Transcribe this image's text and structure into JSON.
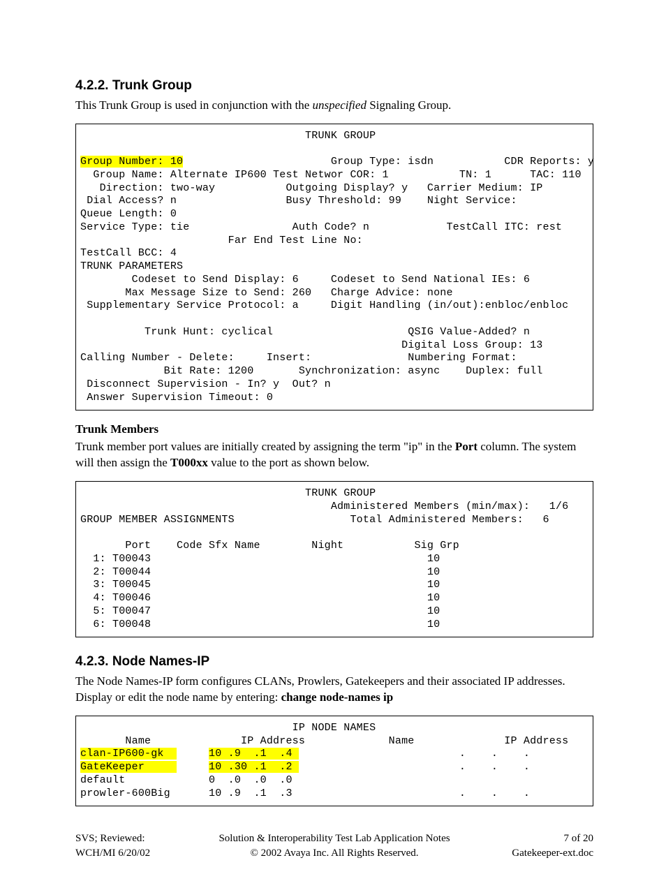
{
  "sections": {
    "trunk_group": {
      "number": "4.2.2.",
      "title": "Trunk Group",
      "intro_a": "This Trunk Group is used in conjunction with the ",
      "intro_b": "unspecified",
      "intro_c": " Signaling Group."
    },
    "trunk_members": {
      "heading": "Trunk Members",
      "p_a": "Trunk member port values are initially created by assigning the term \"ip\" in the ",
      "p_b": "Port",
      "p_c": " column. The system will then assign the ",
      "p_d": "T000xx",
      "p_e": " value to the port as shown below."
    },
    "node_names": {
      "number": "4.2.3.",
      "title": "Node Names-IP",
      "p_a": "The Node Names-IP form configures CLANs, Prowlers, Gatekeepers and their associated IP addresses.   Display or edit the node name by entering: ",
      "p_b": "change node-names ip"
    }
  },
  "terminal1": {
    "title": "                                   TRUNK GROUP",
    "hl_group_number": "Group Number: 10",
    "rest_line_group_number": "                       Group Type: isdn           CDR Reports: y",
    "lines_after": "  Group Name: Alternate IP600 Test Networ COR: 1           TN: 1      TAC: 110\n   Direction: two-way           Outgoing Display? y   Carrier Medium: IP\n Dial Access? n                 Busy Threshold: 99    Night Service:\nQueue Length: 0\nService Type: tie                Auth Code? n            TestCall ITC: rest\n                       Far End Test Line No:\nTestCall BCC: 4\nTRUNK PARAMETERS\n        Codeset to Send Display: 6     Codeset to Send National IEs: 6\n       Max Message Size to Send: 260   Charge Advice: none\n Supplementary Service Protocol: a     Digit Handling (in/out):enbloc/enbloc\n\n          Trunk Hunt: cyclical                     QSIG Value-Added? n\n                                                  Digital Loss Group: 13\nCalling Number - Delete:     Insert:               Numbering Format:\n             Bit Rate: 1200       Synchronization: async    Duplex: full\n Disconnect Supervision - In? y  Out? n\n Answer Supervision Timeout: 0"
  },
  "terminal2": "                                   TRUNK GROUP\n                                       Administered Members (min/max):   1/6\nGROUP MEMBER ASSIGNMENTS                  Total Administered Members:   6\n\n       Port    Code Sfx Name        Night           Sig Grp\n  1: T00043                                           10\n  2: T00044                                           10\n  3: T00045                                           10\n  4: T00046                                           10\n  5: T00047                                           10\n  6: T00048                                           10\n",
  "terminal3": {
    "header": "                                 IP NODE NAMES\n       Name              IP Address             Name              IP Address",
    "rows": [
      {
        "hl": true,
        "name": "clan-IP600-gk  ",
        "ip": "10 .9  .1  .4 ",
        "trail": "                         .    .    ."
      },
      {
        "hl": true,
        "name": "GateKeeper     ",
        "ip": "10 .30 .1  .2 ",
        "trail": "                         .    .    ."
      },
      {
        "hl": false,
        "name": "default        ",
        "ip": "0  .0  .0  .0 ",
        "trail": ""
      },
      {
        "hl": false,
        "name": "prowler-600Big ",
        "ip": "10 .9  .1  .3 ",
        "trail": "                         .    .    ."
      }
    ]
  },
  "footer": {
    "left1": "SVS; Reviewed:",
    "left2": "WCH/MI 6/20/02",
    "center1": "Solution & Interoperability Test Lab Application Notes",
    "center2": "© 2002 Avaya Inc. All Rights Reserved.",
    "right1": "7 of 20",
    "right2": "Gatekeeper-ext.doc"
  }
}
